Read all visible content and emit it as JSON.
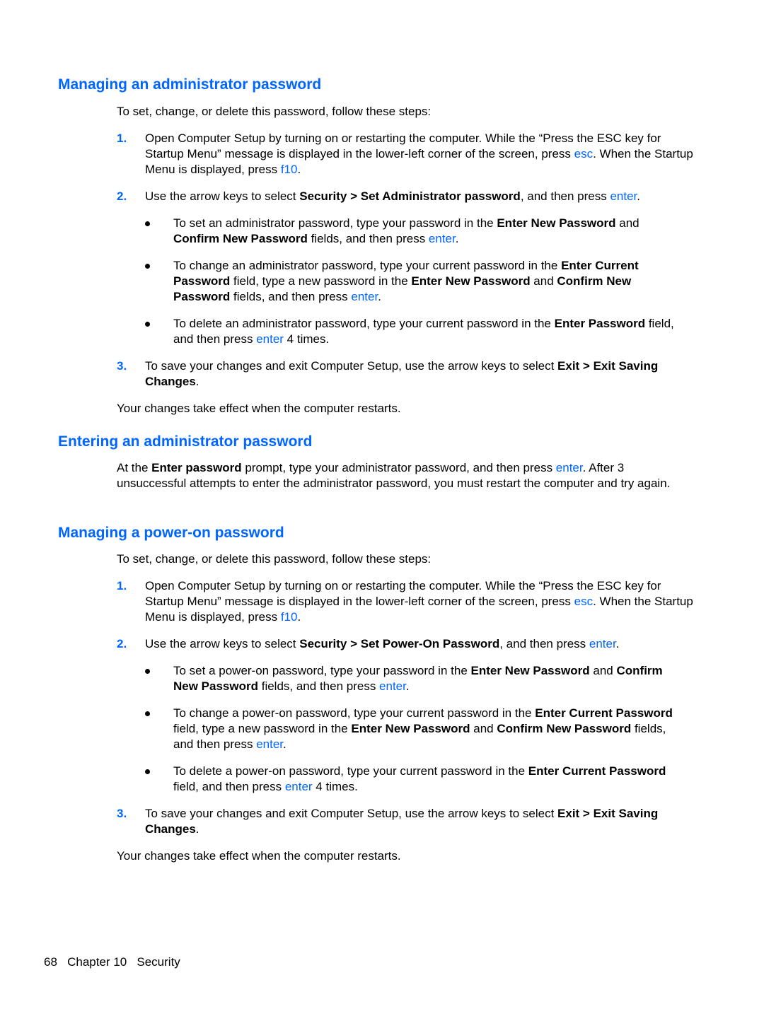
{
  "accent_color": "#0066ff",
  "sections": [
    {
      "heading": "Managing an administrator password",
      "intro": "To set, change, or delete this password, follow these steps:",
      "steps": [
        {
          "num": "1.",
          "parts": [
            "Open Computer Setup by turning on or restarting the computer. While the “Press the ESC key for Startup Menu” message is displayed in the lower-left corner of the screen, press ",
            "esc",
            ". When the Startup Menu is displayed, press ",
            "f10",
            "."
          ]
        },
        {
          "num": "2.",
          "parts": [
            "Use the arrow keys to select ",
            "Security > Set Administrator password",
            ", and then press ",
            "enter",
            "."
          ]
        },
        {
          "num": "3.",
          "parts": [
            "To save your changes and exit Computer Setup, use the arrow keys to select ",
            "Exit > Exit Saving Changes",
            "."
          ]
        }
      ],
      "bullets": [
        {
          "parts": [
            "To set an administrator password, type your password in the ",
            "Enter New Password",
            " and ",
            "Confirm New Password",
            " fields, and then press ",
            "enter",
            "."
          ]
        },
        {
          "parts": [
            "To change an administrator password, type your current password in the ",
            "Enter Current Password",
            " field, type a new password in the ",
            "Enter New Password",
            " and ",
            "Confirm New Password",
            " fields, and then press ",
            "enter",
            "."
          ]
        },
        {
          "parts": [
            "To delete an administrator password, type your current password in the ",
            "Enter Password",
            " field, and then press ",
            "enter",
            " 4 times."
          ]
        }
      ],
      "outro": "Your changes take effect when the computer restarts."
    },
    {
      "heading": "Entering an administrator password",
      "parts": [
        "At the ",
        "Enter password",
        " prompt, type your administrator password, and then press ",
        "enter",
        ". After 3 unsuccessful attempts to enter the administrator password, you must restart the computer and try again."
      ]
    },
    {
      "heading": "Managing a power-on password",
      "intro": "To set, change, or delete this password, follow these steps:",
      "steps": [
        {
          "num": "1.",
          "parts": [
            "Open Computer Setup by turning on or restarting the computer. While the “Press the ESC key for Startup Menu” message is displayed in the lower-left corner of the screen, press ",
            "esc",
            ". When the Startup Menu is displayed, press ",
            "f10",
            "."
          ]
        },
        {
          "num": "2.",
          "parts": [
            "Use the arrow keys to select ",
            "Security > Set Power-On Password",
            ", and then press ",
            "enter",
            "."
          ]
        },
        {
          "num": "3.",
          "parts": [
            "To save your changes and exit Computer Setup, use the arrow keys to select ",
            "Exit > Exit Saving Changes",
            "."
          ]
        }
      ],
      "bullets": [
        {
          "parts": [
            "To set a power-on password, type your password in the ",
            "Enter New Password",
            " and ",
            "Confirm New Password",
            " fields, and then press ",
            "enter",
            "."
          ]
        },
        {
          "parts": [
            "To change a power-on password, type your current password in the ",
            "Enter Current Password",
            " field, type a new password in the ",
            "Enter New Password",
            " and ",
            "Confirm New Password",
            " fields, and then press ",
            "enter",
            "."
          ]
        },
        {
          "parts": [
            "To delete a power-on password, type your current password in the ",
            "Enter Current Password",
            " field, and then press ",
            "enter",
            " 4 times."
          ]
        }
      ],
      "outro": "Your changes take effect when the computer restarts."
    }
  ],
  "footer": {
    "page_number": "68",
    "chapter": "Chapter 10",
    "chapter_title": "Security"
  }
}
